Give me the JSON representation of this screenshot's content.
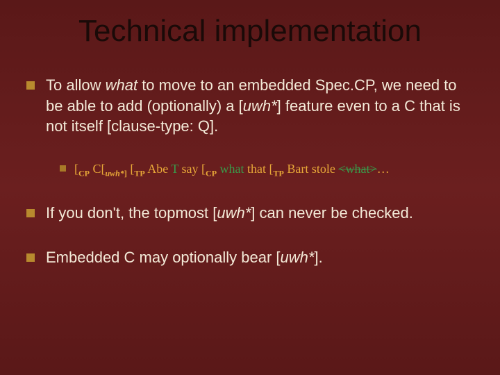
{
  "title": "Technical implementation",
  "bullets": {
    "b1": {
      "pre": "To allow ",
      "what": "what",
      "post1": " to move to an embedded Spec.CP, we need to be able to add (optionally) a [",
      "uwh": "uwh*",
      "post2": "] feature even to a C that is not itself [clause-type: Q]."
    },
    "sub": {
      "lb1": "[",
      "cp1": "CP",
      "c_label": " C[",
      "uwh_sub": "uwh*",
      "rb_c": "]",
      "sp1": " ",
      "lb2": "[",
      "tp1": "TP",
      "abe": " Abe ",
      "t1": "T",
      "say": " say ",
      "lb3": "[",
      "cp2": "CP",
      "what_green": " what",
      "that": " that ",
      "lb4": "[",
      "tp2": "TP",
      "bart": " Bart stole ",
      "what_strike": "<what>",
      "dots": "…"
    },
    "b2": {
      "pre": "If you don't, the topmost [",
      "uwh": "uwh*",
      "post": "] can never be checked."
    },
    "b3": {
      "pre": "Embedded C may optionally bear [",
      "uwh": "uwh*",
      "post": "]."
    }
  }
}
